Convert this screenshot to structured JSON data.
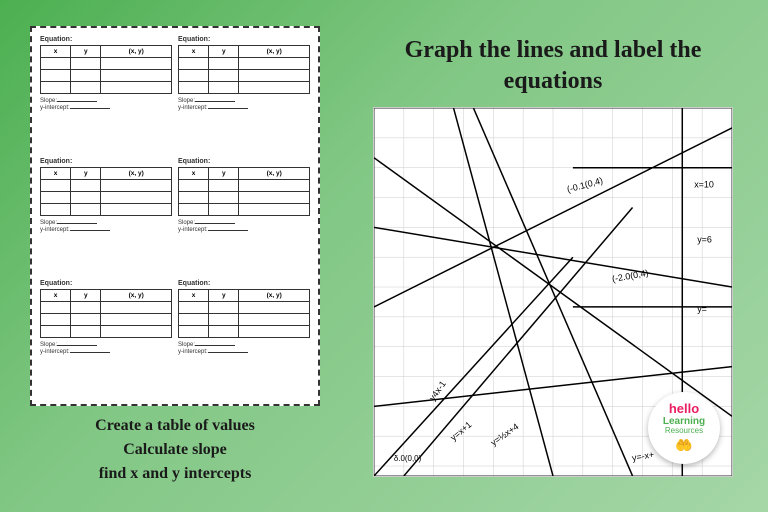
{
  "left": {
    "worksheet_border": "dashed",
    "equation_boxes": [
      {
        "label": "Equation:",
        "headers": [
          "x",
          "y",
          "(x, y)"
        ]
      },
      {
        "label": "Equation:",
        "headers": [
          "x",
          "y",
          "(x, y)"
        ]
      },
      {
        "label": "Equation:",
        "headers": [
          "x",
          "y",
          "(x, y)"
        ]
      },
      {
        "label": "Equation:",
        "headers": [
          "x",
          "y",
          "(x, y)"
        ]
      },
      {
        "label": "Equation:",
        "headers": [
          "x",
          "y",
          "(x, y)"
        ]
      },
      {
        "label": "Equation:",
        "headers": [
          "x",
          "y",
          "(x, y)"
        ]
      }
    ],
    "slope_label": "Slope:__________",
    "intercept_label": "y-intercept:________",
    "caption_lines": [
      "Create a table of values",
      "Calculate slope",
      "find x and y intercepts"
    ]
  },
  "right": {
    "title_line1": "Graph the lines and label the",
    "title_line2": "equations",
    "badge": {
      "hello": "hello",
      "learning": "Learning",
      "resources": "Resources"
    }
  }
}
